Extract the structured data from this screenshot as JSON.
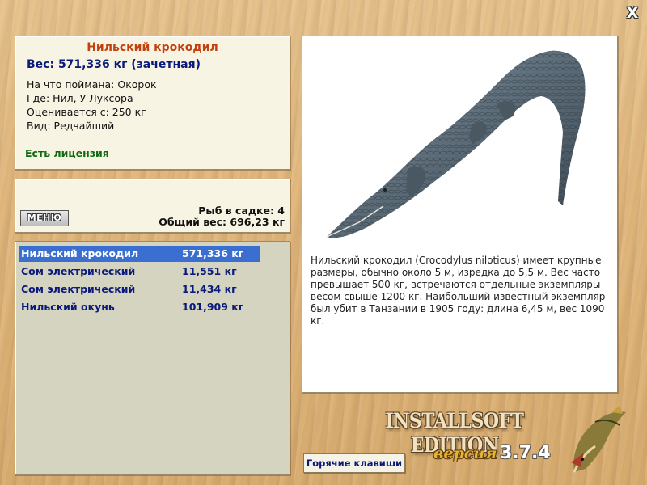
{
  "close_label": "X",
  "fish": {
    "name": "Нильский крокодил",
    "weight": "Вес: 571,336 кг (зачетная)",
    "caught_on": "На что поймана: Окорок",
    "where": "Где: Нил, У Луксора",
    "valued_from": "Оценивается с: 250 кг",
    "kind": "Вид: Редчайший",
    "license": "Есть лицензия"
  },
  "cage": {
    "menu_label": "МЕНЮ",
    "fish_count": "Рыб в садке: 4",
    "total_weight": "Общий вес: 696,23 кг"
  },
  "catch_list": [
    {
      "name": "Нильский крокодил",
      "weight": "571,336 кг",
      "selected": true
    },
    {
      "name": "Сом электрический",
      "weight": "11,551 кг",
      "selected": false
    },
    {
      "name": "Сом электрический",
      "weight": "11,434 кг",
      "selected": false
    },
    {
      "name": "Нильский окунь",
      "weight": "101,909 кг",
      "selected": false
    }
  ],
  "description": "Нильский крокодил (Crocodylus niloticus) имеет крупные размеры, обычно около 5 м, изредка до 5,5 м. Вес часто превышает 500 кг, встречаются отдельные экземпляры весом свыше 1200 кг. Наибольший известный экземпляр был убит в Танзании в 1905 году: длина 6,45 м, вес 1090 кг.",
  "brand": {
    "edition": "INSTALLSOFT EDITION",
    "version_label": "версия",
    "version": "3.7.4"
  },
  "hotkeys_label": "Горячие клавиши",
  "colors": {
    "title": "#c2410f",
    "weight": "#0a1a7a",
    "license": "#0e6a0e",
    "selection": "#3a6fd1"
  },
  "icons": {
    "close": "close-icon",
    "creature": "crocodile-image",
    "logo": "pike-fish-logo"
  }
}
